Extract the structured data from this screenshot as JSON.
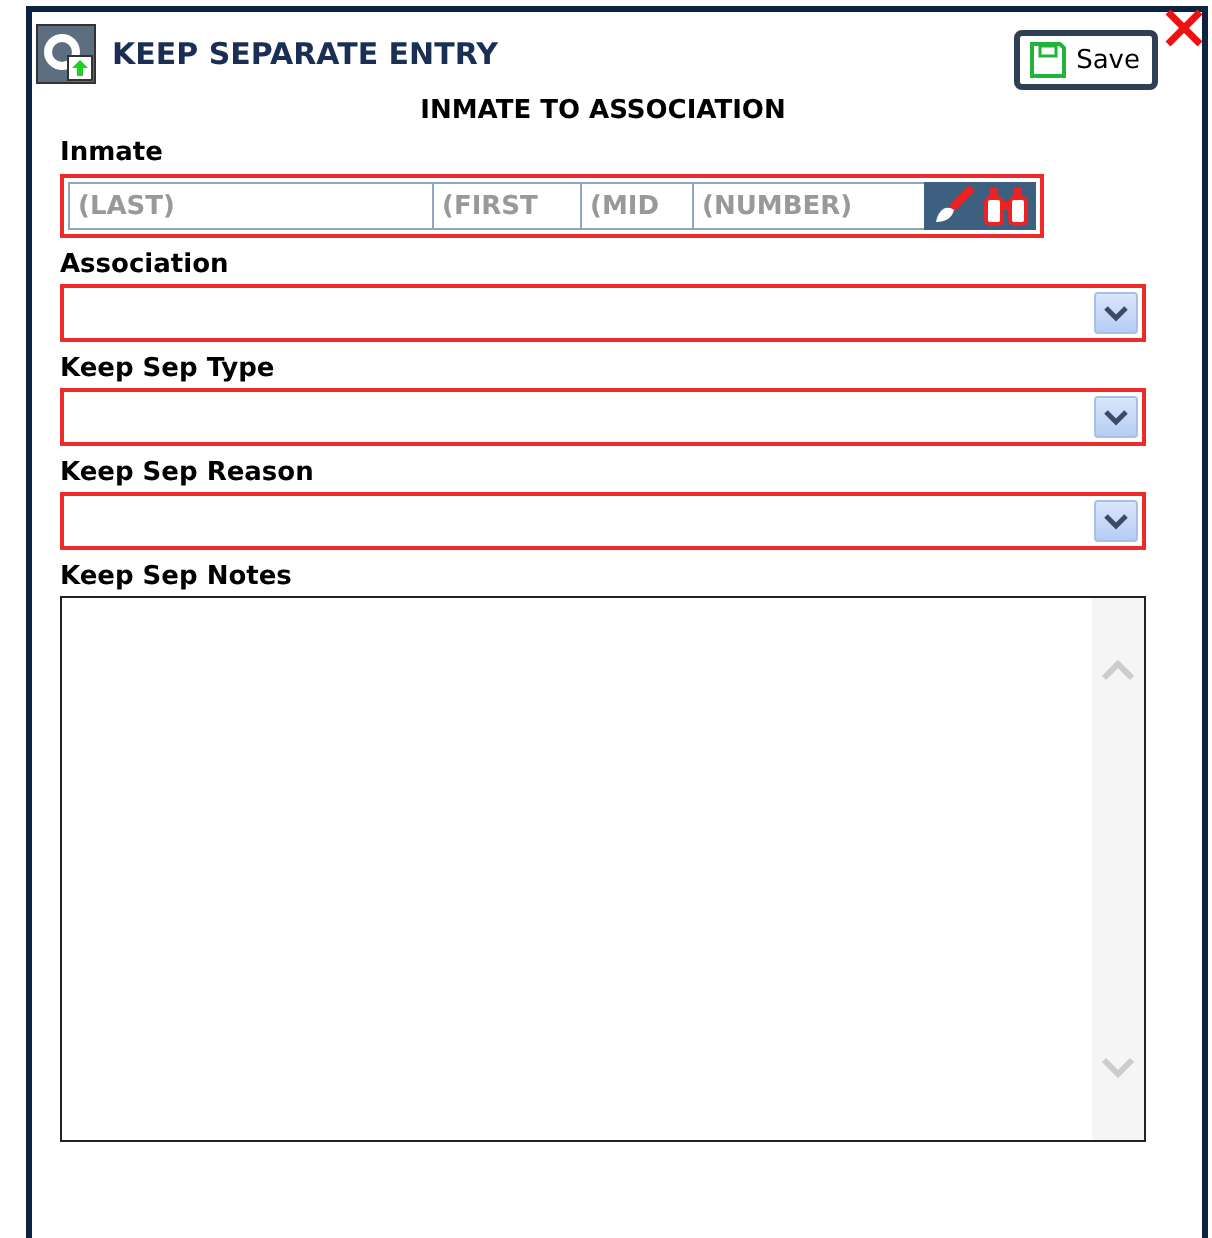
{
  "window": {
    "title": "KEEP SEPARATE ENTRY",
    "save_label": "Save"
  },
  "section_title": "INMATE TO ASSOCIATION",
  "inmate": {
    "label": "Inmate",
    "required": true,
    "parts": [
      {
        "placeholder": "(LAST)"
      },
      {
        "placeholder": "(FIRST"
      },
      {
        "placeholder": "(MID"
      },
      {
        "placeholder": "(NUMBER)"
      }
    ]
  },
  "selects": [
    {
      "label": "Association",
      "required": true
    },
    {
      "label": "Keep Sep Type",
      "required": true
    },
    {
      "label": "Keep Sep Reason",
      "required": true
    }
  ],
  "notes": {
    "label": "Keep Sep Notes",
    "required": false
  }
}
